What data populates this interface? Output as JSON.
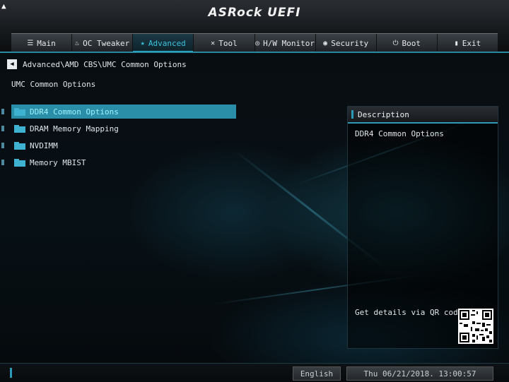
{
  "header": {
    "logo": "ASRock UEFI",
    "tabs": [
      {
        "label": "Main",
        "icon": "list-icon",
        "glyph": "☰"
      },
      {
        "label": "OC Tweaker",
        "icon": "flame-icon",
        "glyph": "♨"
      },
      {
        "label": "Advanced",
        "icon": "star-icon",
        "glyph": "★"
      },
      {
        "label": "Tool",
        "icon": "tools-icon",
        "glyph": "✕"
      },
      {
        "label": "H/W Monitor",
        "icon": "monitor-icon",
        "glyph": "◎"
      },
      {
        "label": "Security",
        "icon": "shield-icon",
        "glyph": "◉"
      },
      {
        "label": "Boot",
        "icon": "power-icon",
        "glyph": "⏻"
      },
      {
        "label": "Exit",
        "icon": "exit-icon",
        "glyph": "▮"
      }
    ],
    "active_tab": "Advanced"
  },
  "breadcrumb": "Advanced\\AMD CBS\\UMC Common Options",
  "page_title": "UMC Common Options",
  "menu": {
    "items": [
      {
        "label": "DDR4 Common Options",
        "selected": true
      },
      {
        "label": "DRAM Memory Mapping",
        "selected": false
      },
      {
        "label": "NVDIMM",
        "selected": false
      },
      {
        "label": "Memory MBIST",
        "selected": false
      }
    ]
  },
  "description": {
    "title": "Description",
    "text": "DDR4 Common Options",
    "qr_label": "Get details via QR code"
  },
  "footer": {
    "language": "English",
    "datetime": "Thu 06/21/2018. 13:00:57"
  },
  "colors": {
    "accent": "#2a8ea8",
    "accent_text": "#39c3dc",
    "folder": "#3fb2d2"
  }
}
